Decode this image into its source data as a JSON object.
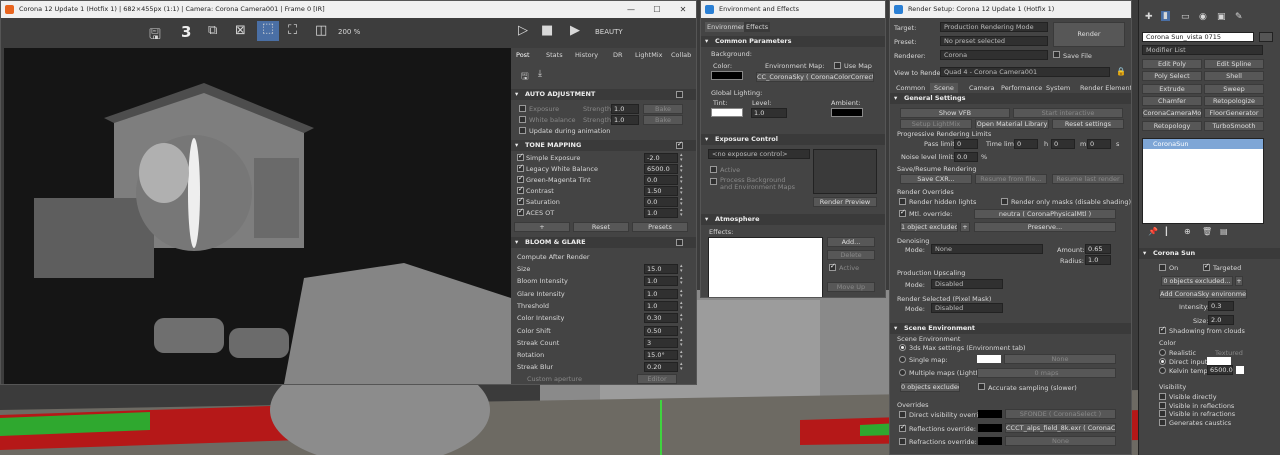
{
  "vfb": {
    "title": "Corona 12 Update 1 (Hotfix 1) | 682×455px (1:1) | Camera: Corona Camera001 | Frame 0 [IR]",
    "toolbar": {
      "passes": "3",
      "zoom": "200 %",
      "render_type": "BEAUTY"
    },
    "tabs": [
      "Post",
      "Stats",
      "History",
      "DR",
      "LightMix",
      "Collab"
    ],
    "auto_adjust": {
      "title": "AUTO ADJUSTMENT",
      "exposure": "Exposure",
      "white_balance": "White balance",
      "strength": "Strength",
      "strength_val": "1.0",
      "bake": "Bake",
      "update": "Update during animation"
    },
    "tone": {
      "title": "TONE MAPPING",
      "rows": [
        {
          "label": "Simple Exposure",
          "value": "-2.0"
        },
        {
          "label": "Legacy White Balance",
          "value": "6500.0"
        },
        {
          "label": "Green-Magenta Tint",
          "value": "0.0"
        },
        {
          "label": "Contrast",
          "value": "1.50"
        },
        {
          "label": "Saturation",
          "value": "0.0"
        },
        {
          "label": "ACES OT",
          "value": "1.0"
        }
      ],
      "add": "+",
      "reset": "Reset",
      "presets": "Presets"
    },
    "bloom": {
      "title": "BLOOM & GLARE",
      "compute": "Compute After Render",
      "rows": [
        {
          "label": "Size",
          "value": "15.0"
        },
        {
          "label": "Bloom Intensity",
          "value": "1.0"
        },
        {
          "label": "Glare Intensity",
          "value": "1.0"
        },
        {
          "label": "Threshold",
          "value": "1.0"
        },
        {
          "label": "Color Intensity",
          "value": "0.30"
        },
        {
          "label": "Color Shift",
          "value": "0.50"
        },
        {
          "label": "Streak Count",
          "value": "3"
        },
        {
          "label": "Rotation",
          "value": "15.0°"
        },
        {
          "label": "Streak Blur",
          "value": "0.20"
        }
      ],
      "aperture": "Custom aperture",
      "editor": "Editor"
    }
  },
  "env": {
    "title": "Environment and Effects",
    "tabs": [
      "Environment",
      "Effects"
    ],
    "common": "Common Parameters",
    "background": "Background:",
    "color": "Color:",
    "env_map": "Environment Map:",
    "use_map": "Use Map",
    "map_name": "CC_CoronaSky  ( CoronaColorCorrect )",
    "global": "Global Lighting:",
    "tint": "Tint:",
    "level": "Level:",
    "level_val": "1.0",
    "ambient": "Ambient:",
    "exposure": "Exposure Control",
    "exposure_sel": "<no exposure control>",
    "active": "Active",
    "process": "Process Background\nand Environment Maps",
    "render_preview": "Render Preview",
    "atmo": "Atmosphere",
    "effects": "Effects:",
    "add": "Add...",
    "delete": "Delete",
    "active2": "Active",
    "move_up": "Move Up"
  },
  "rs": {
    "title": "Render Setup: Corona 12 Update 1 (Hotfix 1)",
    "target_l": "Target:",
    "target": "Production Rendering Mode",
    "preset_l": "Preset:",
    "preset": "No preset selected",
    "renderer_l": "Renderer:",
    "renderer": "Corona",
    "save_file": "Save File",
    "render": "Render",
    "view_l": "View to Render:",
    "view": "Quad 4 - Corona Camera001",
    "tabs": [
      "Common",
      "Scene",
      "Camera",
      "Performance",
      "System",
      "Render Elements"
    ],
    "gs": "General Settings",
    "show_vfb": "Show VFB",
    "start_int": "Start interactive",
    "setup_lm": "Setup LightMix",
    "open_ml": "Open Material Library",
    "reset": "Reset settings",
    "prl": "Progressive Rendering Limits",
    "pass_l": "Pass limit:",
    "pass": "0",
    "time_l": "Time limit:",
    "t_h": "0",
    "h": "h",
    "t_m": "0",
    "m": "m",
    "t_s": "0",
    "s": "s",
    "noise_l": "Noise level limit:",
    "noise": "0.0",
    "pct": "%",
    "sr": "Save/Resume Rendering",
    "save_cxr": "Save CXR...",
    "resume_file": "Resume from file...",
    "resume_last": "Resume last render",
    "ro": "Render Overrides",
    "hidden": "Render hidden lights",
    "mask": "Render only masks (disable shading)",
    "mtl": "Mtl. override:",
    "mtl_val": "neutra  ( CoronaPhysicalMtl )",
    "excluded": "1 object excluded...",
    "plus": "+",
    "preserve": "Preserve...",
    "denoise": "Denoising",
    "mode_l": "Mode:",
    "mode": "None",
    "amount_l": "Amount:",
    "amount": "0.65",
    "radius_l": "Radius:",
    "radius": "1.0",
    "upscale": "Production Upscaling",
    "up_mode": "Disabled",
    "rsel": "Render Selected (Pixel Mask)",
    "rsel_mode": "Disabled",
    "se": "Scene Environment",
    "se_sub": "Scene Environment",
    "max_set": "3ds Max settings (Environment tab)",
    "single": "Single map:",
    "none": "None",
    "multiple": "Multiple maps (LightMix):",
    "maps": "0 maps",
    "obj_ex": "0 objects excluded...",
    "acc": "Accurate sampling (slower)",
    "ov": "Overrides",
    "dvo": "Direct visibility override:",
    "dvo_val": "SFONDE  ( CoronaSelect )",
    "ref": "Reflections override:",
    "ref_val": "CCCT_alps_field_8k.exr  ( CoronaColor",
    "refr": "Refractions override:",
    "refr_val": "None"
  },
  "cmd": {
    "object": "Corona Sun_vista 0715",
    "modlist": "Modifier List",
    "mods": [
      "Edit Poly",
      "Edit Spline",
      "Poly Select",
      "Shell",
      "Extrude",
      "Sweep",
      "Chamfer",
      "Retopologize",
      "CoronaCameraMod",
      "FloorGenerator",
      "Retopology",
      "TurboSmooth"
    ],
    "stack_item": "CoronaSun",
    "rollout": "Corona Sun",
    "on": "On",
    "targeted": "Targeted",
    "excluded": "0 objects excluded...",
    "add_sky": "Add CoronaSky environment",
    "intensity_l": "Intensity:",
    "intensity": "0.3",
    "size_l": "Size:",
    "size": "2.0",
    "shadow": "Shadowing from clouds",
    "color": "Color",
    "realistic": "Realistic",
    "textured": "Textured",
    "direct": "Direct input",
    "kelvin": "Kelvin temp",
    "kelvin_val": "6500.0",
    "visibility": "Visibility",
    "vis": [
      "Visible directly",
      "Visible in reflections",
      "Visible in refractions",
      "Generates caustics"
    ]
  },
  "colors": {
    "accent": "#4a6fa5",
    "sel": "#7ea6d6"
  }
}
